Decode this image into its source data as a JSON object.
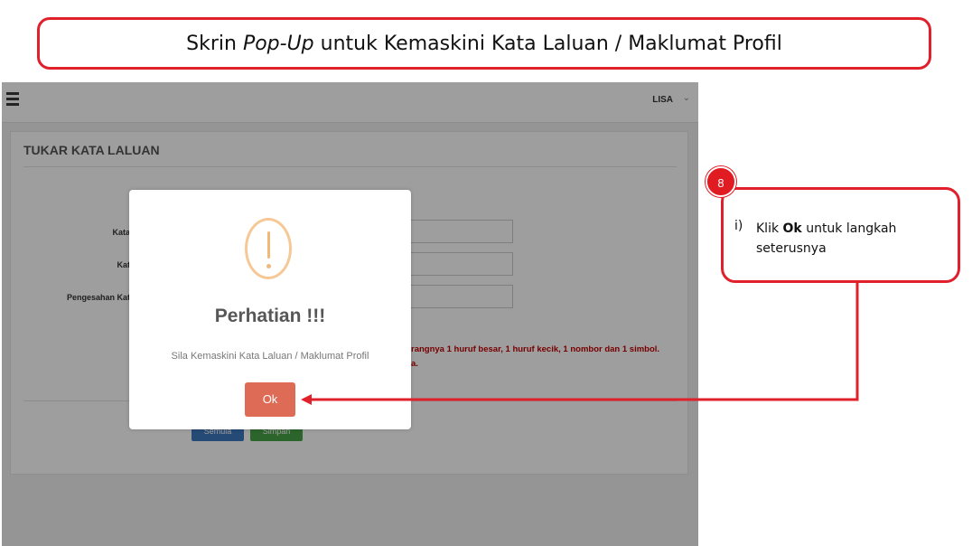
{
  "slide": {
    "title_pre": "Skrin ",
    "title_em": "Pop-Up",
    "title_post": " untuk Kemaskini Kata Laluan / Maklumat Profil"
  },
  "app": {
    "menu_icon": "hamburger-icon",
    "user_name": "LISA",
    "user_caret": "⌄",
    "panel_title": "TUKAR KATA LALUAN",
    "fields": [
      {
        "label": "Kata",
        "value": ""
      },
      {
        "label": "Kat",
        "value": ""
      },
      {
        "label": "Pengesahan Kat",
        "value": ""
      }
    ],
    "note_line1": "rangnya 1 huruf besar, 1 huruf kecik, 1 nombor dan 1 simbol.",
    "note_line2": "a.",
    "back_button": "Semula",
    "save_button": "Simpan"
  },
  "dialog": {
    "icon": "exclamation-warning-icon",
    "title": "Perhatian !!!",
    "message": "Sila Kemaskini Kata Laluan / Maklumat Profil",
    "ok_label": "Ok"
  },
  "callout": {
    "step": "8",
    "item_num": "i)",
    "text_pre": "Klik ",
    "text_bold": "Ok",
    "text_post": " untuk langkah seterusnya"
  },
  "colors": {
    "accent_red": "#e0202a",
    "ok_button": "#dd6b55",
    "warning_orange": "#f6c896"
  }
}
